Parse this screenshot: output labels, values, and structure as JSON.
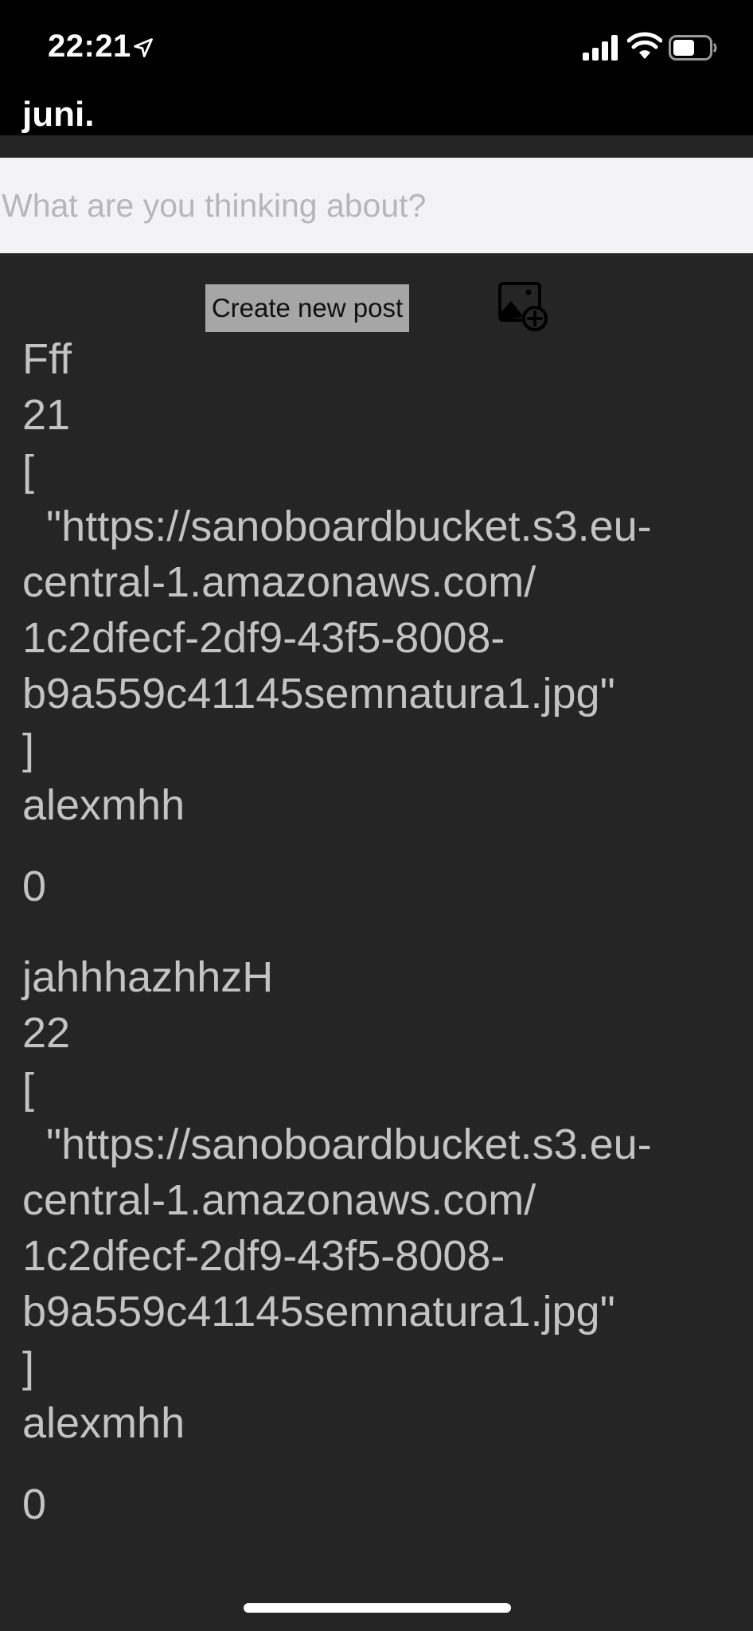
{
  "status_bar": {
    "time": "22:21"
  },
  "header": {
    "title": "juni."
  },
  "composer": {
    "placeholder": "What are you thinking about?",
    "create_label": "Create new post"
  },
  "icons": {
    "location": "location-arrow-icon",
    "signal": "cellular-signal-icon",
    "wifi": "wifi-icon",
    "battery": "battery-icon",
    "add_image": "add-image-icon"
  },
  "colors": {
    "background": "#252525",
    "bar": "#000000",
    "input_bg": "#f2f2f7",
    "button_bg": "#a6a6a6",
    "text": "#c3c3c3"
  },
  "posts": [
    {
      "title": "Fff",
      "id": "21",
      "images_open": "[",
      "image_url_lines": [
        "  \"https://sanoboardbucket.s3.eu-",
        "central-1.amazonaws.com/",
        "1c2dfecf-2df9-43f5-8008-",
        "b9a559c41145semnatura1.jpg\""
      ],
      "images_close": "]",
      "author": "alexmhh",
      "likes": "0"
    },
    {
      "title": "jahhhazhhzH",
      "id": "22",
      "images_open": "[",
      "image_url_lines": [
        "  \"https://sanoboardbucket.s3.eu-",
        "central-1.amazonaws.com/",
        "1c2dfecf-2df9-43f5-8008-",
        "b9a559c41145semnatura1.jpg\""
      ],
      "images_close": "]",
      "author": "alexmhh",
      "likes": "0"
    }
  ]
}
